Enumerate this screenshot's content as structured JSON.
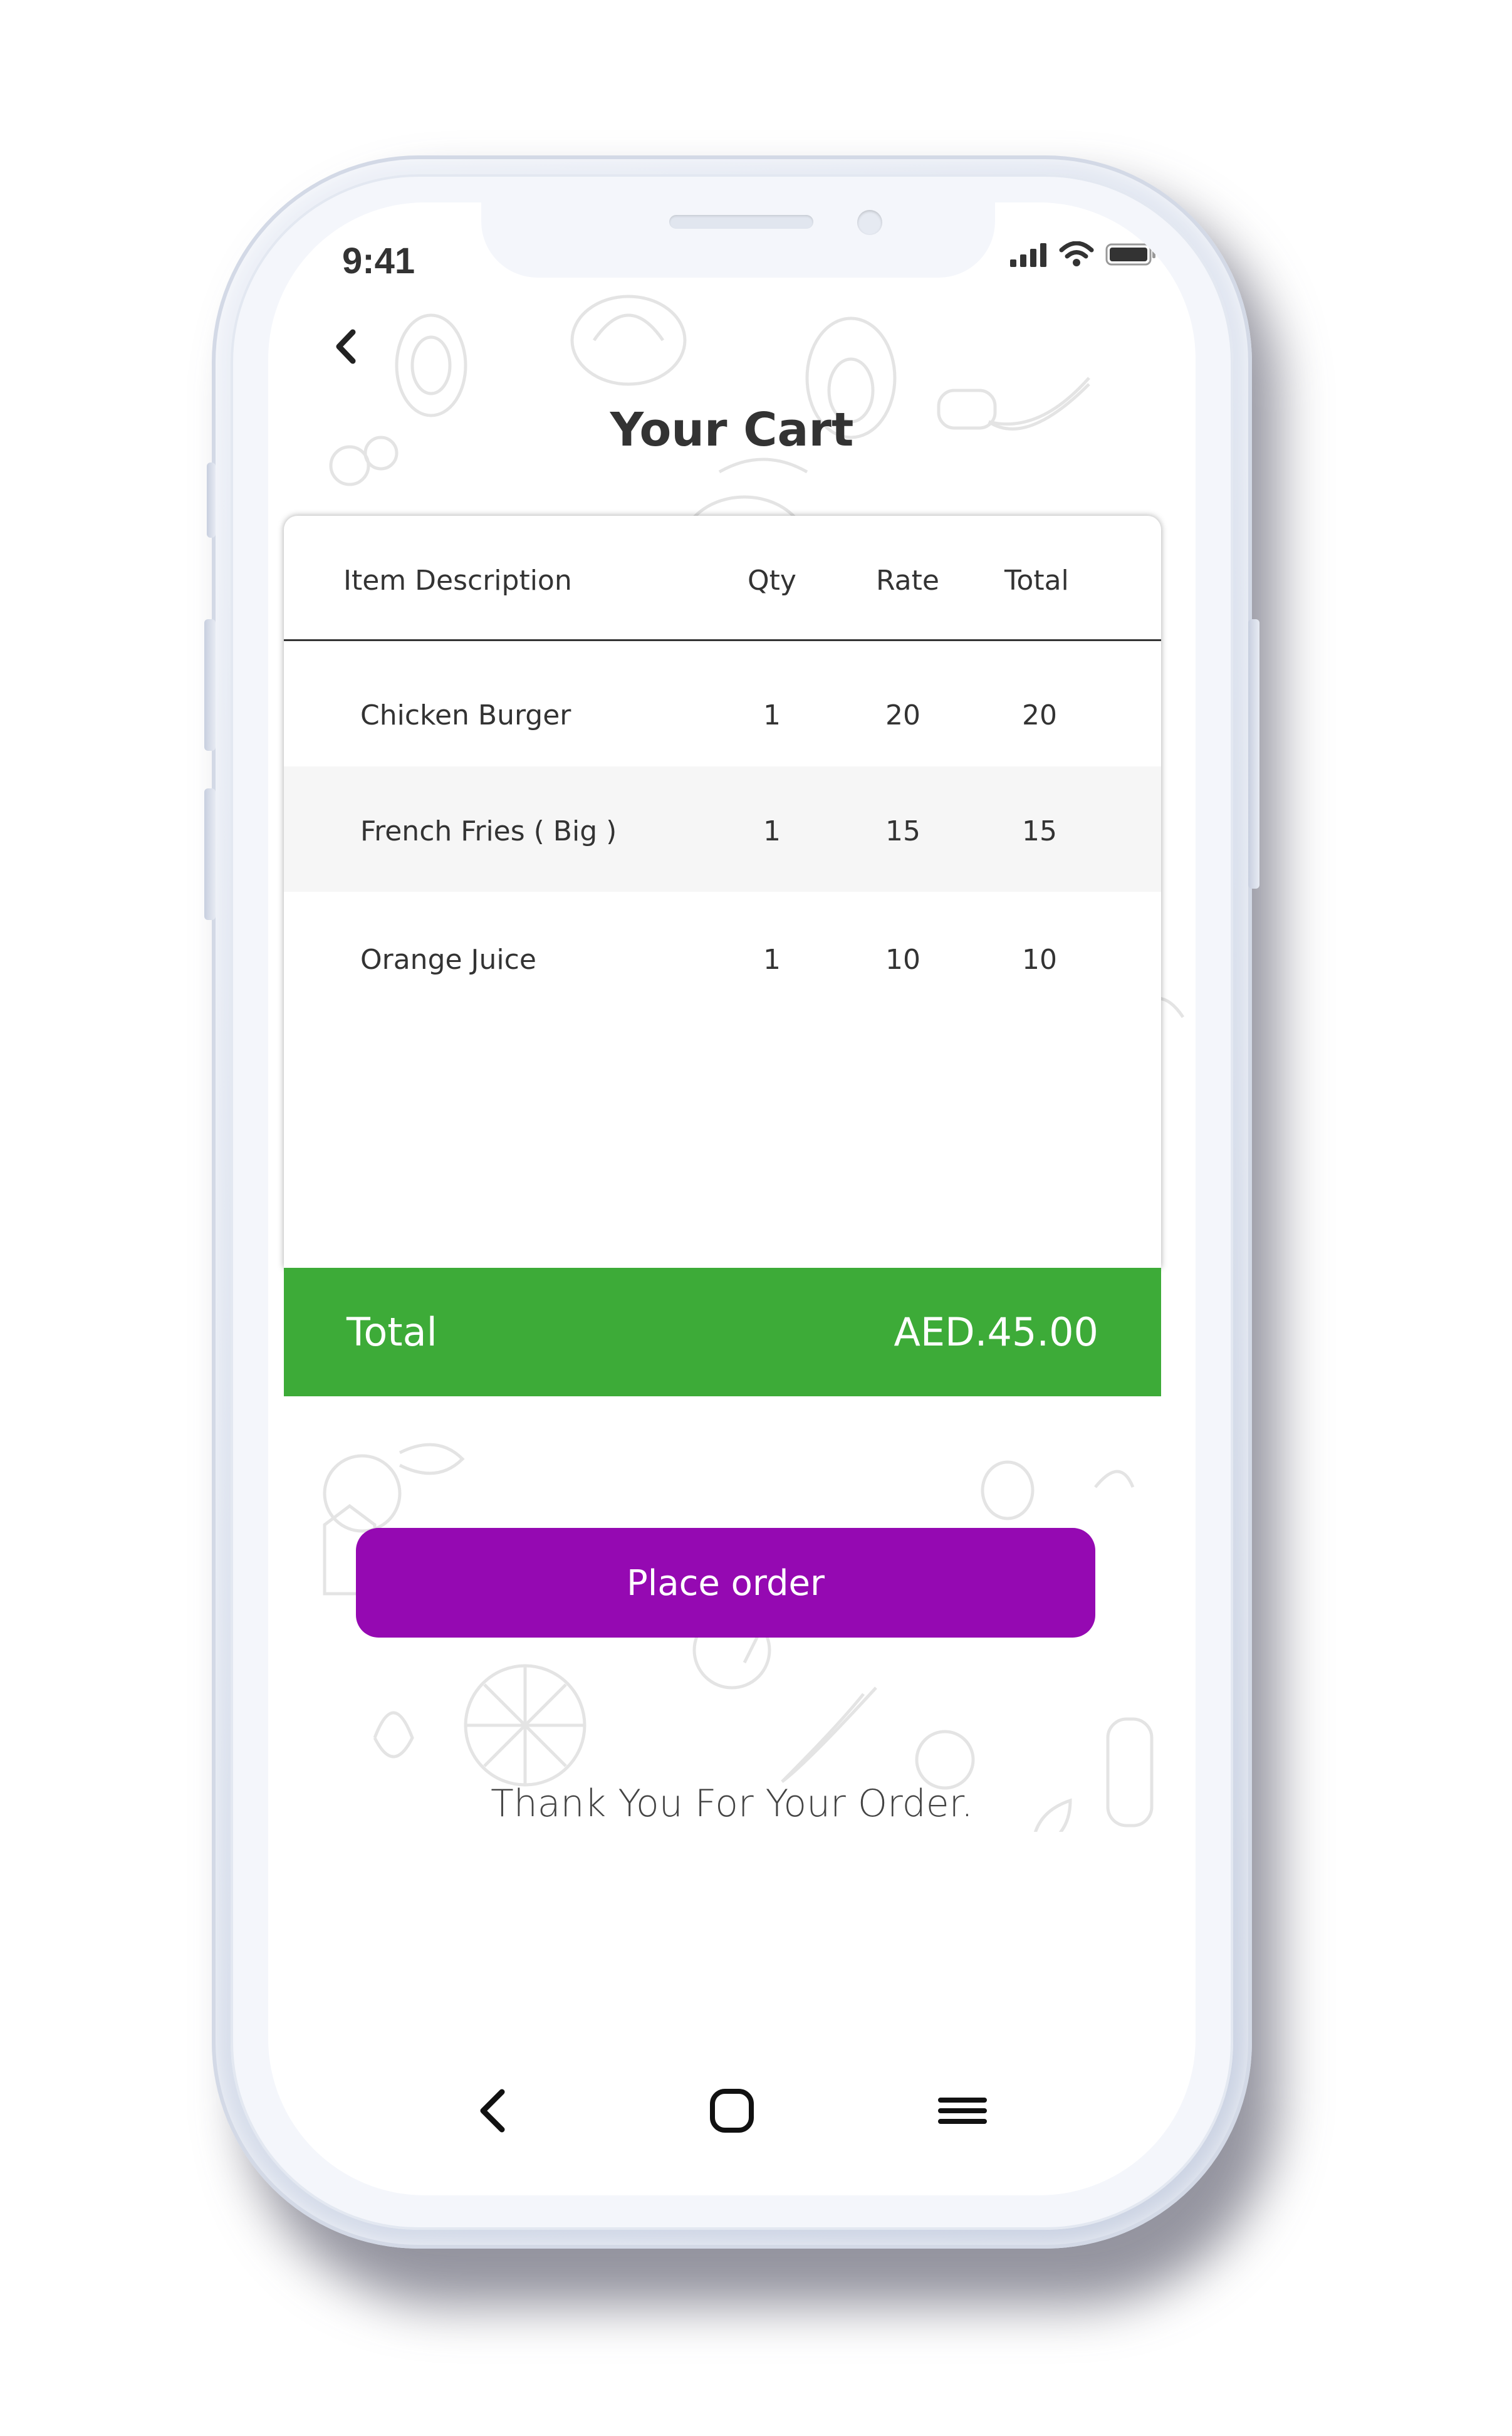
{
  "status_bar": {
    "time": "9:41",
    "icons": [
      "signal-icon",
      "wifi-icon",
      "battery-icon"
    ]
  },
  "header": {
    "back_icon": "chevron-left-icon",
    "title": "Your Cart"
  },
  "cart": {
    "columns": [
      "Item Description",
      "Qty",
      "Rate",
      "Total"
    ],
    "rows": [
      {
        "description": "Chicken Burger",
        "qty": "1",
        "rate": "20",
        "total": "20"
      },
      {
        "description": "French Fries ( Big )",
        "qty": "1",
        "rate": "15",
        "total": "15"
      },
      {
        "description": "Orange Juice",
        "qty": "1",
        "rate": "10",
        "total": "10"
      }
    ],
    "total_label": "Total",
    "total_value": "AED.45.00"
  },
  "actions": {
    "place_order_label": "Place order"
  },
  "message": {
    "thank_you": "Thank You For Your Order."
  },
  "nav_bar": {
    "icons": [
      "back-icon",
      "home-icon",
      "menu-icon"
    ]
  },
  "colors": {
    "total_bar": "#3dab38",
    "place_order_button": "#9509b2",
    "text": "#333333"
  }
}
